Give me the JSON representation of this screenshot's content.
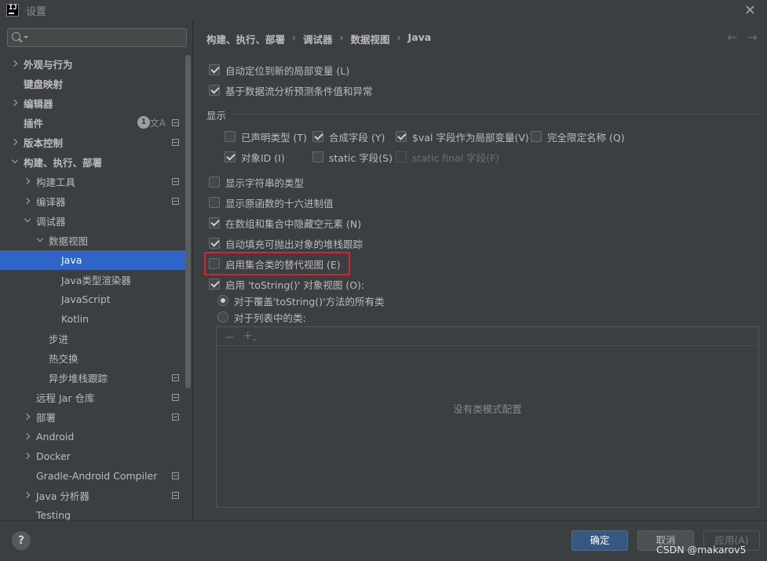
{
  "window": {
    "title": "设置"
  },
  "search": {
    "placeholder": ""
  },
  "sidebar": {
    "items": [
      {
        "label": "外观与行为",
        "level": 0,
        "arrow": "right",
        "bold": true
      },
      {
        "label": "键盘映射",
        "level": 0,
        "arrow": "none",
        "bold": true
      },
      {
        "label": "编辑器",
        "level": 0,
        "arrow": "right",
        "bold": true
      },
      {
        "label": "插件",
        "level": 0,
        "arrow": "none",
        "bold": true,
        "badge": "1",
        "translate": "文A",
        "project": true
      },
      {
        "label": "版本控制",
        "level": 0,
        "arrow": "right",
        "bold": true,
        "project": true
      },
      {
        "label": "构建、执行、部署",
        "level": 0,
        "arrow": "down",
        "bold": true
      },
      {
        "label": "构建工具",
        "level": 1,
        "arrow": "right",
        "project": true
      },
      {
        "label": "编译器",
        "level": 1,
        "arrow": "right",
        "project": true
      },
      {
        "label": "调试器",
        "level": 1,
        "arrow": "down"
      },
      {
        "label": "数据视图",
        "level": 2,
        "arrow": "down"
      },
      {
        "label": "Java",
        "level": 3,
        "arrow": "none",
        "selected": true
      },
      {
        "label": "Java类型渲染器",
        "level": 3,
        "arrow": "none"
      },
      {
        "label": "JavaScript",
        "level": 3,
        "arrow": "none"
      },
      {
        "label": "Kotlin",
        "level": 3,
        "arrow": "none"
      },
      {
        "label": "步进",
        "level": 2,
        "arrow": "none"
      },
      {
        "label": "热交换",
        "level": 2,
        "arrow": "none"
      },
      {
        "label": "异步堆栈跟踪",
        "level": 2,
        "arrow": "none",
        "project": true
      },
      {
        "label": "远程 Jar 仓库",
        "level": 1,
        "arrow": "none",
        "project": true
      },
      {
        "label": "部署",
        "level": 1,
        "arrow": "right",
        "project": true
      },
      {
        "label": "Android",
        "level": 1,
        "arrow": "right"
      },
      {
        "label": "Docker",
        "level": 1,
        "arrow": "right"
      },
      {
        "label": "Gradle-Android Compiler",
        "level": 1,
        "arrow": "none",
        "project": true
      },
      {
        "label": "Java 分析器",
        "level": 1,
        "arrow": "right",
        "project": true
      },
      {
        "label": "Testing",
        "level": 1,
        "arrow": "none"
      }
    ]
  },
  "breadcrumb": [
    "构建、执行、部署",
    "调试器",
    "数据视图",
    "Java"
  ],
  "breadcrumb_sep": "›",
  "nav": {
    "back": "←",
    "forward": "→"
  },
  "options": {
    "auto_locate": {
      "label": "自动定位到新的局部变量 (L)",
      "checked": true
    },
    "dataflow": {
      "label": "基于数据流分析预测条件值和异常",
      "checked": true
    },
    "section_display": "显示",
    "declared_type": {
      "label": "已声明类型 (T)",
      "checked": false
    },
    "synthetic": {
      "label": "合成字段 (Y)",
      "checked": true
    },
    "val_fields": {
      "label": "$val 字段作为局部变量(V)",
      "checked": true
    },
    "fqn": {
      "label": "完全限定名称 (Q)",
      "checked": false
    },
    "object_id": {
      "label": "对象ID (I)",
      "checked": true
    },
    "static_fields": {
      "label": "static 字段(S)",
      "checked": false
    },
    "static_final": {
      "label": "static final 字段(F)",
      "checked": false,
      "disabled": true
    },
    "string_type": {
      "label": "显示字符串的类型",
      "checked": false
    },
    "hex": {
      "label": "显示原函数的十六进制值",
      "checked": false
    },
    "hide_null": {
      "label": "在数组和集合中隐藏空元素 (N)",
      "checked": true
    },
    "stacktrace": {
      "label": "自动填充可抛出对象的堆栈跟踪",
      "checked": true
    },
    "alt_view": {
      "label": "启用集合类的替代视图 (E)",
      "checked": false
    },
    "tostring_view": {
      "label": "启用 'toString()' 对象视图 (O):",
      "checked": true
    },
    "radio_all": {
      "label": "对于覆盖'toString()'方法的所有类",
      "checked": true
    },
    "radio_list": {
      "label": "对于列表中的类:",
      "checked": false
    }
  },
  "list": {
    "minus": "−",
    "plus": "+",
    "empty": "没有类模式配置"
  },
  "footer": {
    "help": "?",
    "ok": "确定",
    "cancel": "取消",
    "apply": "应用(A)",
    "watermark": "CSDN @makarov5"
  },
  "colors": {
    "selected_bg": "#2f65ca",
    "highlight": "#e0212b",
    "ok_button": "#365880"
  }
}
